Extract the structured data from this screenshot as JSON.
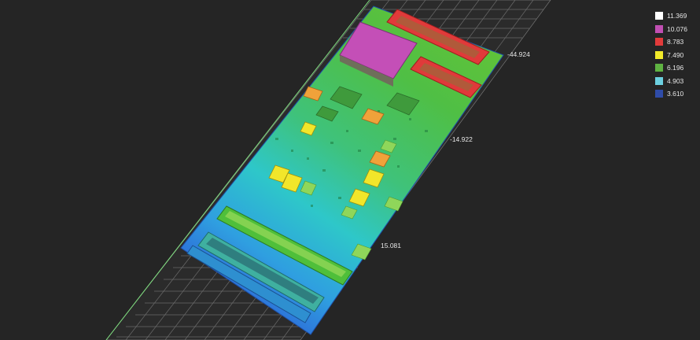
{
  "scene": {
    "axis_labels": [
      "-44.924",
      "-14.922",
      "15.081"
    ]
  },
  "legend": {
    "items": [
      {
        "value": "11.369",
        "color": "#ffffff"
      },
      {
        "value": "10.076",
        "color": "#c14fb3"
      },
      {
        "value": "8.783",
        "color": "#e23b3b"
      },
      {
        "value": "7.490",
        "color": "#f2ea2a"
      },
      {
        "value": "6.196",
        "color": "#5fb342"
      },
      {
        "value": "4.903",
        "color": "#6cd0e0"
      },
      {
        "value": "3.610",
        "color": "#2f4ca8"
      }
    ]
  }
}
